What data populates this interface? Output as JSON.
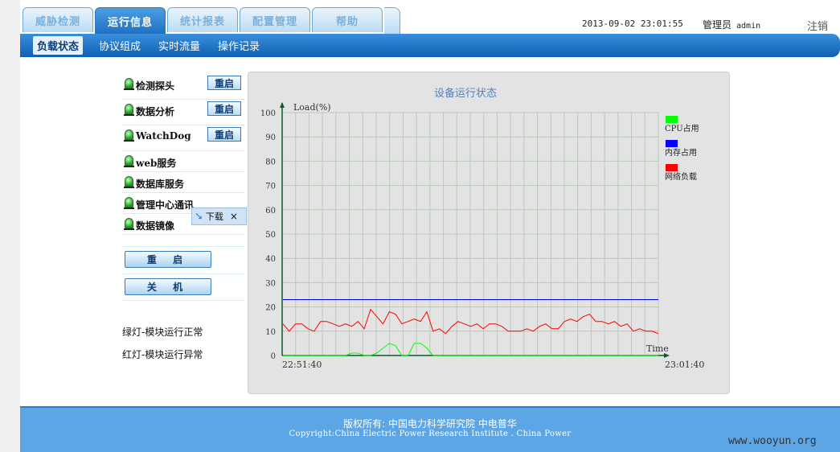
{
  "header": {
    "tabs": [
      {
        "label": "威胁检测",
        "active": false
      },
      {
        "label": "运行信息",
        "active": true
      },
      {
        "label": "统计报表",
        "active": false
      },
      {
        "label": "配置管理",
        "active": false
      },
      {
        "label": "帮助",
        "active": false
      }
    ],
    "datetime": "2013-09-02 23:01:55",
    "user_role": "管理员",
    "user_name": "admin",
    "logout_label": "注销"
  },
  "subnav": {
    "items": [
      {
        "label": "负载状态",
        "active": true
      },
      {
        "label": "协议组成",
        "active": false
      },
      {
        "label": "实时流量",
        "active": false
      },
      {
        "label": "操作记录",
        "active": false
      }
    ]
  },
  "modules": [
    {
      "name": "检测探头",
      "restart_label": "重启",
      "status": "green"
    },
    {
      "name": "数据分析",
      "restart_label": "重启",
      "status": "green"
    },
    {
      "name": "WatchDog",
      "restart_label": "重启",
      "status": "green"
    },
    {
      "name": "web服务",
      "status": "green"
    },
    {
      "name": "数据库服务",
      "status": "green"
    },
    {
      "name": "管理中心通讯",
      "status": "green"
    },
    {
      "name": "数据镜像",
      "status": "green"
    }
  ],
  "download_tip": {
    "label": "下载",
    "close": "×"
  },
  "actions": {
    "restart_all": "重 启",
    "shutdown": "关 机"
  },
  "legend_notes": {
    "green": "绿灯-模块运行正常",
    "red": "红灯-模块运行异常"
  },
  "chart_data": {
    "type": "line",
    "title": "设备运行状态",
    "ylabel": "Load(%)",
    "xlabel": "Time",
    "ylim": [
      0,
      100
    ],
    "yticks": [
      0,
      10,
      20,
      30,
      40,
      50,
      60,
      70,
      80,
      90,
      100
    ],
    "x_start_label": "22:51:40",
    "x_end_label": "23:01:40",
    "grid": true,
    "legend_position": "right",
    "series": [
      {
        "name": "CPU占用",
        "color": "#00ff00",
        "values": [
          0,
          0,
          0,
          0,
          0,
          0,
          0,
          0,
          0,
          0,
          0,
          1,
          1,
          0,
          0,
          1,
          3,
          5,
          4,
          0,
          0,
          5,
          5,
          3,
          0,
          0,
          0,
          0,
          0,
          0,
          0,
          0,
          0,
          0,
          0,
          0,
          0,
          0,
          0,
          0,
          0,
          0,
          0,
          0,
          0,
          0,
          0,
          0,
          0,
          0,
          0,
          0,
          0,
          0,
          0,
          0,
          0,
          0,
          0,
          0,
          0
        ]
      },
      {
        "name": "内存占用",
        "color": "#0000ff",
        "values": [
          23,
          23,
          23,
          23,
          23,
          23,
          23,
          23,
          23,
          23,
          23,
          23,
          23,
          23,
          23,
          23,
          23,
          23,
          23,
          23,
          23,
          23,
          23,
          23,
          23,
          23,
          23,
          23,
          23,
          23,
          23,
          23,
          23,
          23,
          23,
          23,
          23,
          23,
          23,
          23,
          23,
          23,
          23,
          23,
          23,
          23,
          23,
          23,
          23,
          23,
          23,
          23,
          23,
          23,
          23,
          23,
          23,
          23,
          23,
          23,
          23
        ]
      },
      {
        "name": "网络负载",
        "color": "#ff0000",
        "values": [
          13,
          10,
          13,
          13,
          11,
          10,
          14,
          14,
          13,
          12,
          13,
          12,
          14,
          11,
          19,
          16,
          13,
          18,
          17,
          13,
          14,
          15,
          14,
          18,
          10,
          11,
          9,
          12,
          14,
          13,
          12,
          13,
          11,
          13,
          13,
          12,
          10,
          10,
          10,
          11,
          10,
          12,
          13,
          11,
          11,
          14,
          15,
          14,
          16,
          17,
          14,
          14,
          13,
          14,
          12,
          13,
          10,
          11,
          10,
          10,
          9
        ]
      }
    ]
  },
  "footer": {
    "line1": "版权所有: 中国电力科学研究院  中电普华",
    "line2": "Copyright:China Electric Power Research Institute . China Power"
  },
  "watermark": "www.wooyun.org"
}
